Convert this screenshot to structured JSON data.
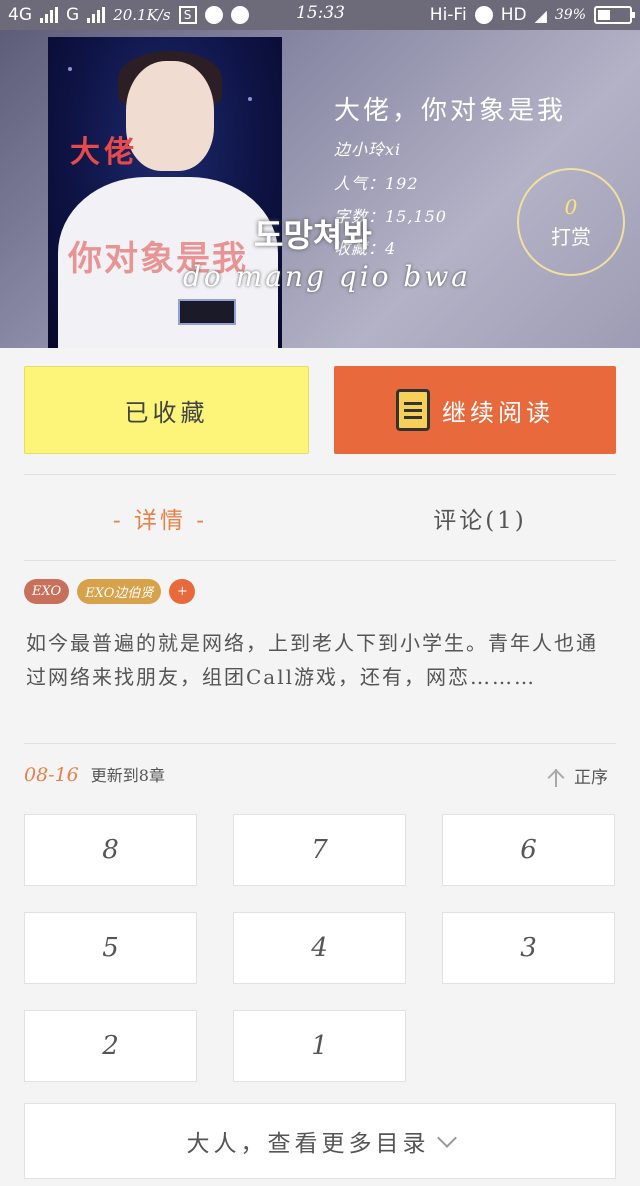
{
  "status_bar": {
    "network1": "4G",
    "network2": "G",
    "speed": "20.1K/s",
    "time": "15:33",
    "wifi_label": "Hi-Fi",
    "hd": "HD",
    "battery": "39%"
  },
  "book": {
    "title": "大佬，你对象是我",
    "author": "边小玲xi",
    "popularity": "人气：192",
    "word_count": "字数：15,150",
    "favorites": "收藏：4",
    "overlay_korean": "도망쳐봐",
    "overlay_romanization": "do mang qio bwa",
    "cover_title": "大佬",
    "cover_subtitle": "你对象是我"
  },
  "tip": {
    "count": "0",
    "label": "打赏"
  },
  "actions": {
    "favorite_label": "已收藏",
    "read_label": "继续阅读"
  },
  "tabs": {
    "details": "- 详情 -",
    "comments": "评论(1)"
  },
  "tags": [
    {
      "label": "EXO",
      "color": "#c9705c"
    },
    {
      "label": "EXO边伯贤",
      "color": "#d7a24a"
    },
    {
      "label": "+",
      "color": "#e8693c"
    }
  ],
  "description": "如今最普遍的就是网络，上到老人下到小学生。青年人也通过网络来找朋友，组团Call游戏，还有，网恋………",
  "update": {
    "date": "08-16",
    "text": "更新到8章",
    "sort_label": "正序"
  },
  "chapters": [
    "8",
    "7",
    "6",
    "5",
    "4",
    "3",
    "2",
    "1"
  ],
  "more_catalog": "大人，查看更多目录"
}
